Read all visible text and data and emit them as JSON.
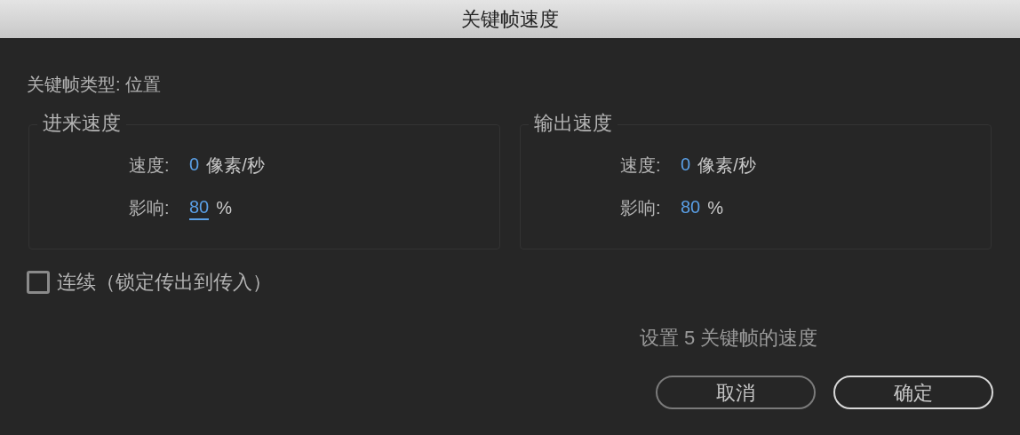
{
  "window": {
    "title": "关键帧速度"
  },
  "keyframe_type": {
    "label": "关键帧类型:",
    "value": "位置"
  },
  "panels": [
    {
      "title": "进来速度",
      "speed": {
        "label": "速度:",
        "value": "0",
        "unit": "像素/秒",
        "focused": false
      },
      "influence": {
        "label": "影响:",
        "value": "80",
        "unit": "%",
        "focused": true
      }
    },
    {
      "title": "输出速度",
      "speed": {
        "label": "速度:",
        "value": "0",
        "unit": "像素/秒",
        "focused": false
      },
      "influence": {
        "label": "影响:",
        "value": "80",
        "unit": "%",
        "focused": false
      }
    }
  ],
  "continuous": {
    "label": "连续（锁定传出到传入）",
    "checked": false
  },
  "status": "设置 5 关键帧的速度",
  "buttons": [
    {
      "label": "取消",
      "default": false
    },
    {
      "label": "确定",
      "default": true
    }
  ]
}
